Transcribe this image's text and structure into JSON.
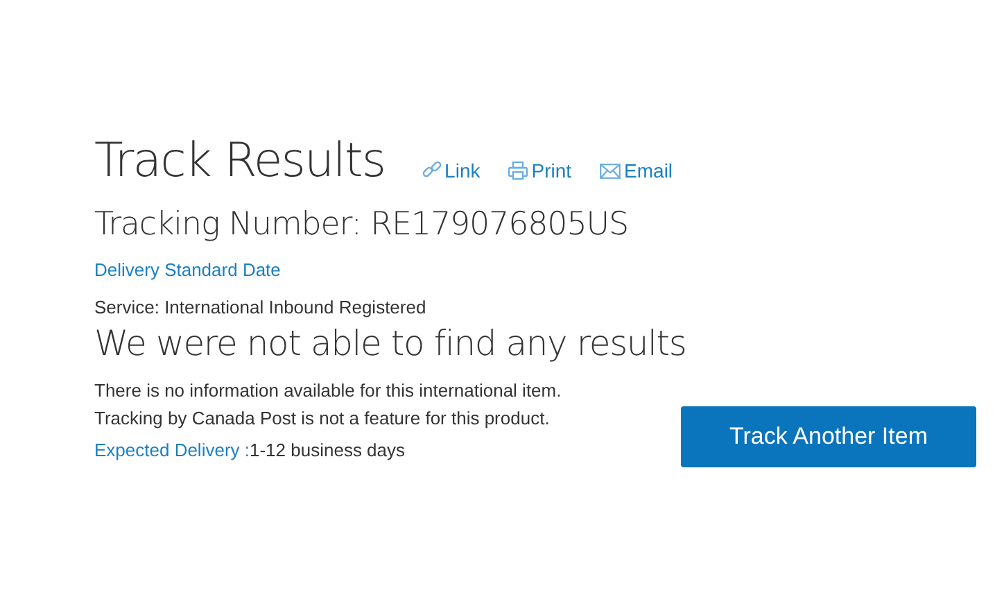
{
  "title": "Track Results",
  "actions": [
    {
      "kind": "link",
      "label": "Link"
    },
    {
      "kind": "print",
      "label": "Print"
    },
    {
      "kind": "email",
      "label": "Email"
    }
  ],
  "tracking_number": "Tracking Number: RE179076805US",
  "delivery_standard_link": "Delivery Standard Date",
  "service": "Service: International Inbound Registered",
  "message_heading": "We were not able to find any results",
  "message_lines": [
    "There is no information available for this international item.",
    "Tracking by Canada Post is not a feature for this product."
  ],
  "expected_delivery": {
    "label": "Expected Delivery :",
    "value": "1-12 business days"
  },
  "track_another_button": "Track Another Item"
}
